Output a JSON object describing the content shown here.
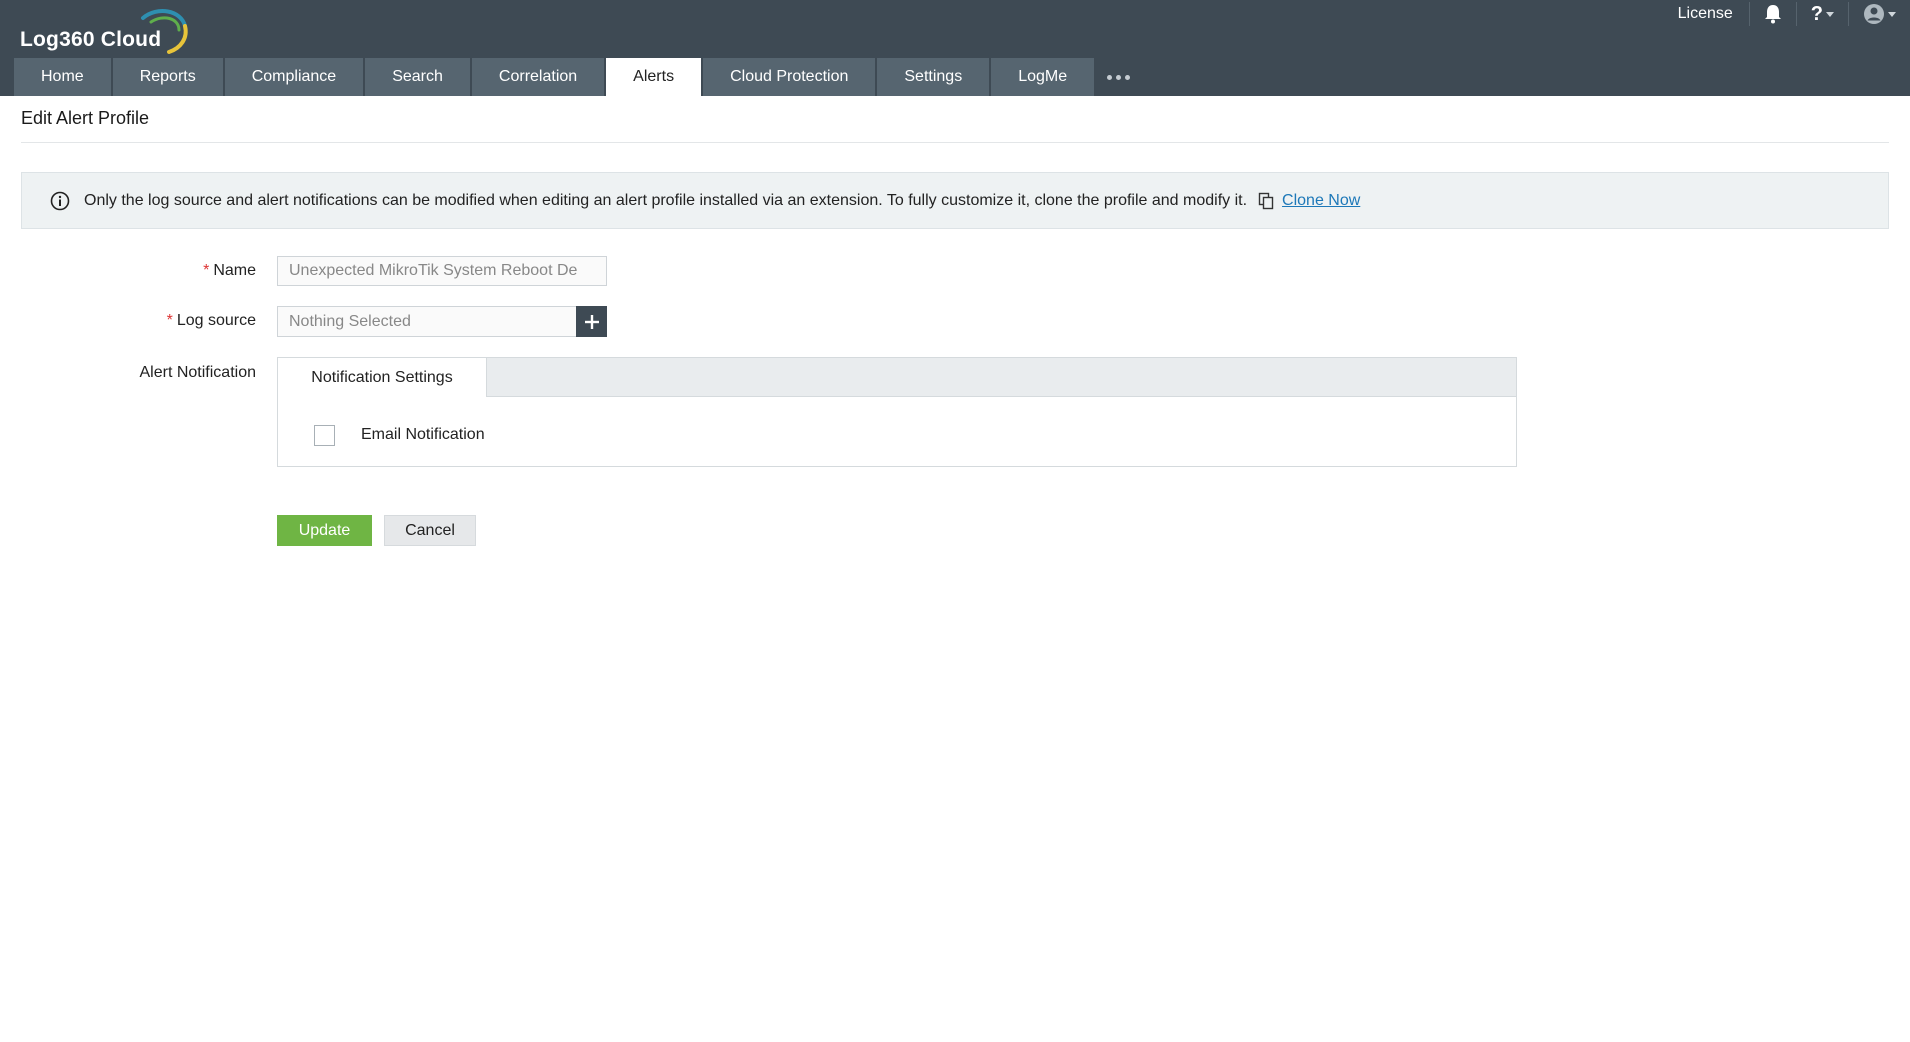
{
  "app": {
    "logo_text": "Log360  Cloud"
  },
  "header": {
    "license_label": "License",
    "help_label": "?"
  },
  "nav": {
    "tabs": [
      {
        "label": "Home"
      },
      {
        "label": "Reports"
      },
      {
        "label": "Compliance"
      },
      {
        "label": "Search"
      },
      {
        "label": "Correlation"
      },
      {
        "label": "Alerts",
        "active": true
      },
      {
        "label": "Cloud Protection"
      },
      {
        "label": "Settings"
      },
      {
        "label": "LogMe"
      }
    ]
  },
  "page": {
    "title": "Edit Alert Profile"
  },
  "banner": {
    "message": "Only the log source and alert notifications can be modified when editing an alert profile installed via an extension. To fully customize it, clone the profile and modify it.",
    "link_label": "Clone Now"
  },
  "form": {
    "required_mark": "*",
    "name_label": "Name",
    "name_value": "Unexpected MikroTik System Reboot De",
    "log_source_label": "Log source",
    "log_source_placeholder": "Nothing Selected",
    "alert_notification_label": "Alert Notification",
    "notification_tab": "Notification Settings",
    "email_notification_label": "Email Notification",
    "email_notification_checked": false
  },
  "actions": {
    "update_label": "Update",
    "cancel_label": "Cancel"
  },
  "colors": {
    "header_bg": "#3e4a54",
    "tab_bg": "#566570",
    "update_green": "#6fb544",
    "link_blue": "#1d78b8",
    "required_red": "#d33"
  }
}
